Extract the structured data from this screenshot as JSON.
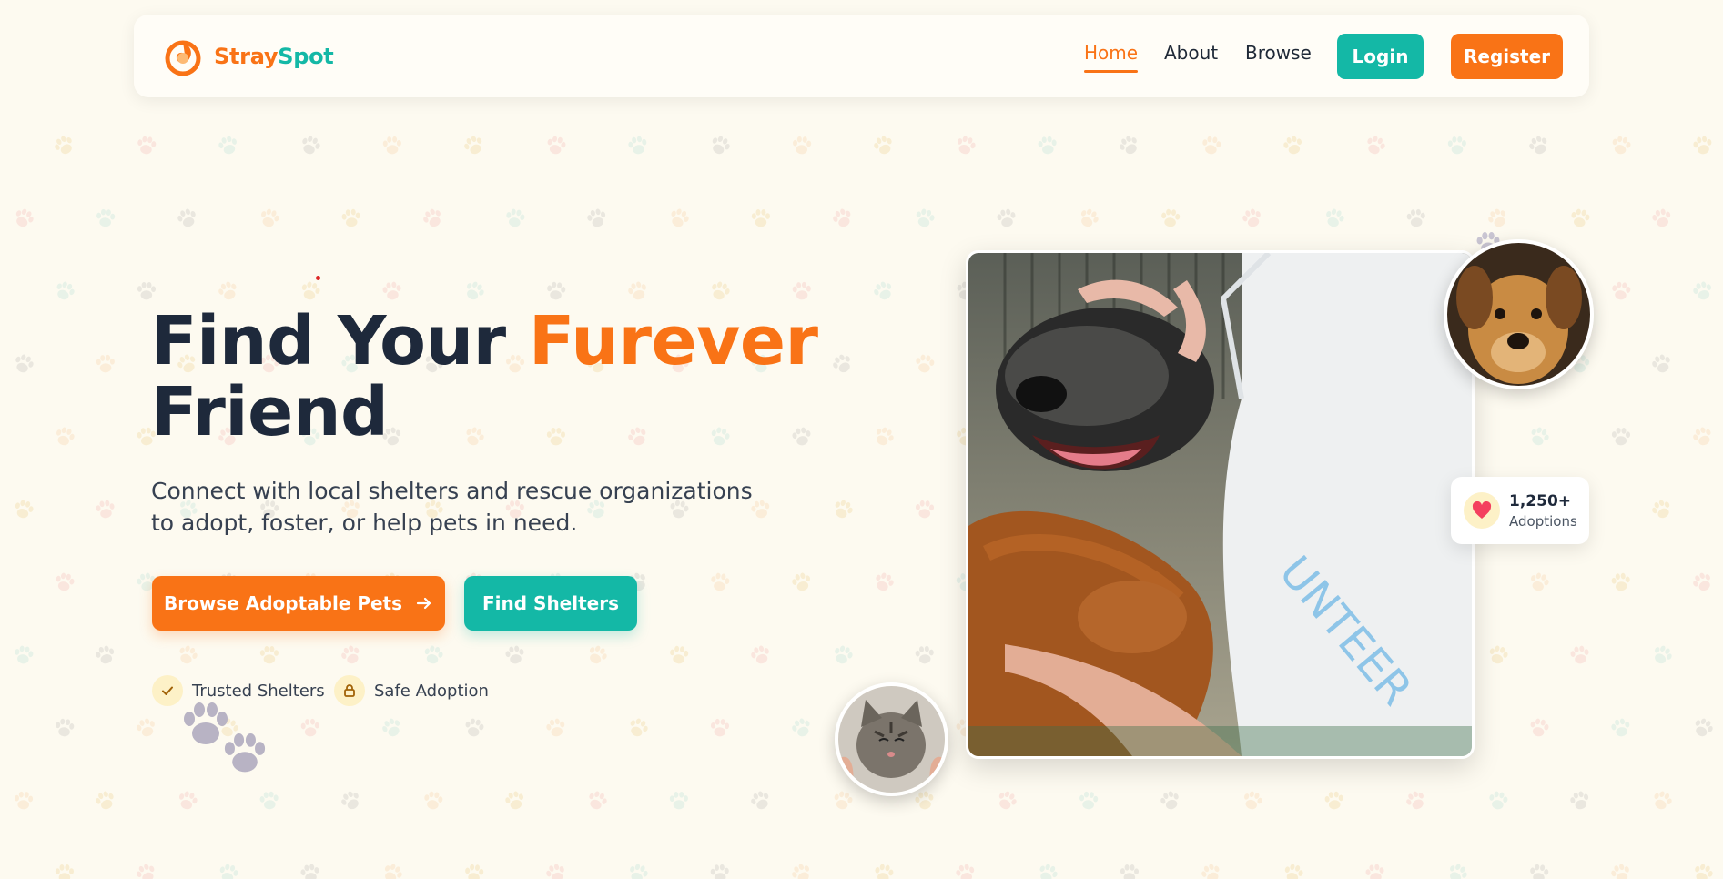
{
  "brand": {
    "name_part1": "Stray",
    "name_part2": "Spot",
    "primary_color": "#f97316",
    "secondary_color": "#14b8a6",
    "logo_icon": "flame-swirl-icon"
  },
  "nav": {
    "links": [
      {
        "label": "Home",
        "active": true
      },
      {
        "label": "About",
        "active": false
      },
      {
        "label": "Browse",
        "active": false
      }
    ],
    "login_label": "Login",
    "register_label": "Register"
  },
  "hero": {
    "title_part1": "Find Your ",
    "title_accent": "Furever",
    "title_part2": "Friend",
    "subtitle_line1": "Connect with local shelters and rescue organizations",
    "subtitle_line2": "to adopt, foster, or help pets in need.",
    "primary_cta": "Browse Adoptable Pets",
    "primary_cta_icon": "arrow-right-icon",
    "secondary_cta": "Find Shelters",
    "badges": [
      {
        "label": "Trusted Shelters",
        "icon": "check-icon"
      },
      {
        "label": "Safe Adoption",
        "icon": "lock-icon"
      }
    ]
  },
  "gallery": {
    "main_photo": "two dogs with volunteer",
    "top_photo": "brown dog portrait",
    "bottom_photo": "tabby cat being petted"
  },
  "stats": {
    "value": "1,250+",
    "label": "Adoptions",
    "icon": "heart-icon"
  }
}
